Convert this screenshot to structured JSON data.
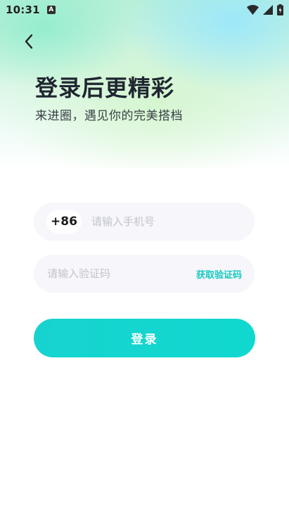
{
  "status_bar": {
    "time": "10:31",
    "notification_icon_label": "A"
  },
  "header": {
    "title": "登录后更精彩",
    "subtitle": "来进圈，遇见你的完美搭档"
  },
  "form": {
    "country_code": "+86",
    "phone_placeholder": "请输入手机号",
    "code_placeholder": "请输入验证码",
    "get_code_label": "获取验证码",
    "login_label": "登录"
  },
  "colors": {
    "accent": "#19c9c0",
    "button": "#10d8cf",
    "field_bg": "#f6f6fb",
    "title": "#1f2630"
  }
}
